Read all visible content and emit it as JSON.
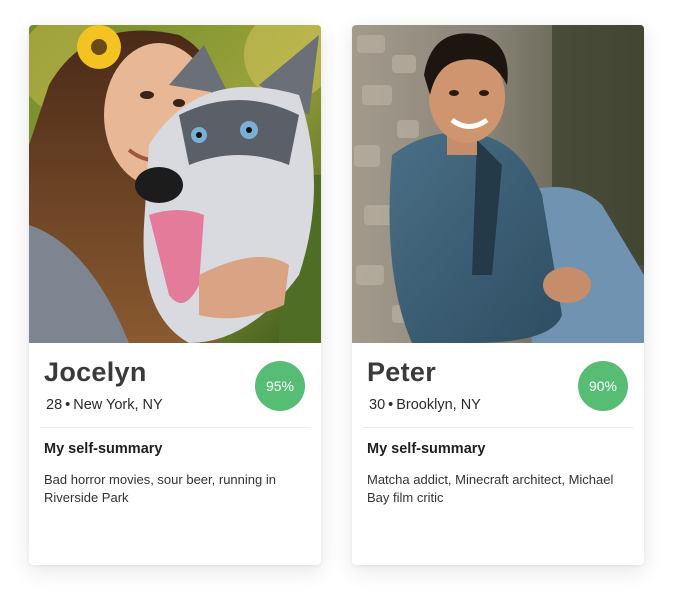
{
  "profiles": [
    {
      "name": "Jocelyn",
      "age": "28",
      "separator": "•",
      "location": "New York, NY",
      "match": "95%",
      "summary_heading": "My self-summary",
      "summary": "Bad horror movies, sour beer, running in Riverside Park",
      "photo_icon": "photo-woman-with-husky"
    },
    {
      "name": "Peter",
      "age": "30",
      "separator": "•",
      "location": "Brooklyn, NY",
      "match": "90%",
      "summary_heading": "My self-summary",
      "summary": "Matcha addict, Minecraft architect, Michael Bay film critic",
      "photo_icon": "photo-man-denim-jacket"
    }
  ],
  "colors": {
    "match_badge": "#57bd75",
    "card_background": "#ffffff"
  }
}
